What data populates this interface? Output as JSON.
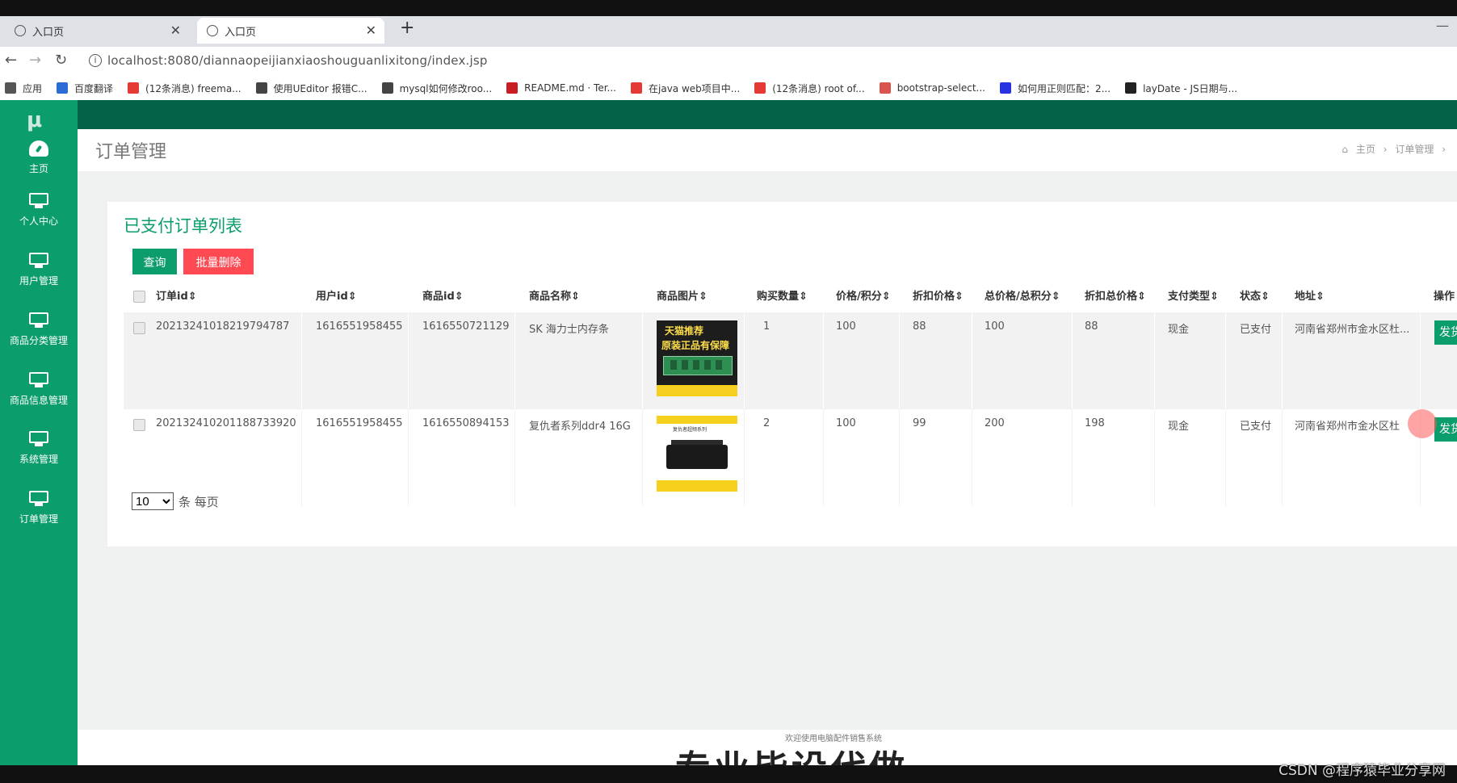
{
  "browser": {
    "tabs": [
      {
        "title": "入口页",
        "active": false
      },
      {
        "title": "入口页",
        "active": true
      }
    ],
    "new_tab": "+",
    "url": "localhost:8080/diannaopeijianxiaoshouguanlixitong/index.jsp",
    "bookmarks": [
      {
        "label": "应用",
        "icon": "apps-grid-icon",
        "color": "#555555"
      },
      {
        "label": "百度翻译",
        "icon": "baidu-translate-icon",
        "color": "#2b6cd4"
      },
      {
        "label": "(12条消息) freema...",
        "icon": "csdn-icon",
        "color": "#e53935"
      },
      {
        "label": "使用UEditor 报错C...",
        "icon": "link-icon",
        "color": "#444444"
      },
      {
        "label": "mysql如何修改roo...",
        "icon": "link-icon",
        "color": "#444444"
      },
      {
        "label": "README.md · Ter...",
        "icon": "gitee-icon",
        "color": "#c71d23"
      },
      {
        "label": "在java web项目中...",
        "icon": "csdn-icon",
        "color": "#e53935"
      },
      {
        "label": "(12条消息) root of...",
        "icon": "csdn-icon",
        "color": "#e53935"
      },
      {
        "label": "bootstrap-select...",
        "icon": "bootstrap-icon",
        "color": "#d9534f"
      },
      {
        "label": "如何用正则匹配：2...",
        "icon": "baidu-icon",
        "color": "#2932e1"
      },
      {
        "label": "layDate - JS日期与...",
        "icon": "laydate-icon",
        "color": "#222222"
      }
    ]
  },
  "sidebar": {
    "logo": "μ",
    "items": [
      {
        "label": "主页",
        "icon": "dashboard-icon"
      },
      {
        "label": "个人中心",
        "icon": "monitor-icon"
      },
      {
        "label": "用户管理",
        "icon": "monitor-icon"
      },
      {
        "label": "商品分类管理",
        "icon": "monitor-icon"
      },
      {
        "label": "商品信息管理",
        "icon": "monitor-icon"
      },
      {
        "label": "系统管理",
        "icon": "monitor-icon"
      },
      {
        "label": "订单管理",
        "icon": "monitor-icon"
      }
    ]
  },
  "header": {
    "title": "订单管理",
    "breadcrumb": {
      "home": "主页",
      "sep": "›",
      "current": "订单管理"
    }
  },
  "card": {
    "title": "已支付订单列表",
    "query_button": "查询",
    "bulk_delete_button": "批量删除"
  },
  "table": {
    "columns": [
      "订单id",
      "用户id",
      "商品id",
      "商品名称",
      "商品图片",
      "购买数量",
      "价格/积分",
      "折扣价格",
      "总价格/总积分",
      "折扣总价格",
      "支付类型",
      "状态",
      "地址",
      "操作"
    ],
    "rows": [
      {
        "order_id": "20213241018219794787",
        "user_id": "1616551958455",
        "product_id": "1616550721129",
        "product_name": "SK 海力士内存条",
        "image_text": [
          "天猫推荐",
          "原装正品有保障"
        ],
        "quantity": "1",
        "price": "100",
        "discount_price": "88",
        "total": "100",
        "discount_total": "88",
        "pay_type": "现金",
        "status": "已支付",
        "address": "河南省郑州市金水区杜...",
        "action": "发货"
      },
      {
        "order_id": "20213241020118873392​0",
        "user_id": "1616551958455",
        "product_id": "1616550894153",
        "product_name": "复仇者系列ddr4 16G",
        "image_text": [
          "复仇者超频系列"
        ],
        "quantity": "2",
        "price": "100",
        "discount_price": "99",
        "total": "200",
        "discount_total": "198",
        "pay_type": "现金",
        "status": "已支付",
        "address": "河南省郑州市金水区杜",
        "action": "发货"
      }
    ]
  },
  "pager": {
    "page_size": "10",
    "suffix": "条 每页"
  },
  "footer": {
    "small": "欢迎使用电脑配件销售系统",
    "big": "专业毕设代做"
  },
  "watermark": "CSDN @程序猿毕业分享网",
  "colors": {
    "primary": "#0b9d6b",
    "topbar": "#036349",
    "danger": "#ff4a54"
  }
}
